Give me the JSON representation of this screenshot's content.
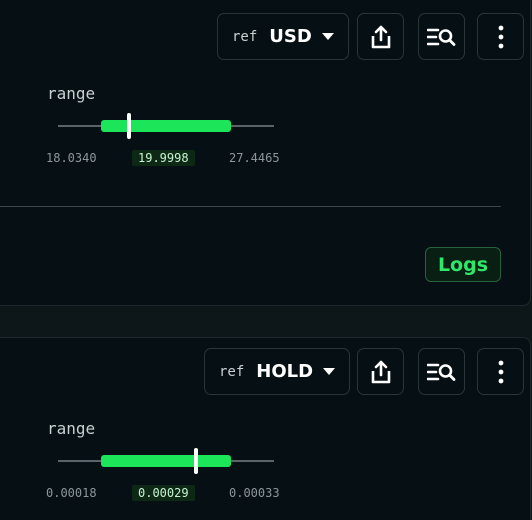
{
  "panels": [
    {
      "ref_prefix": "ref",
      "ref_value": "USD",
      "range_label": "range",
      "range_min": "18.0340",
      "range_current": "19.9998",
      "range_max": "27.4465",
      "range_low_fraction": 0.2,
      "range_high_fraction": 0.8,
      "range_marker_fraction": 0.33
    },
    {
      "ref_prefix": "ref",
      "ref_value": "HOLD",
      "range_label": "range",
      "range_min": "0.00018",
      "range_current": "0.00029",
      "range_max": "0.00033",
      "range_low_fraction": 0.2,
      "range_high_fraction": 0.8,
      "range_marker_fraction": 0.64
    }
  ],
  "logs_label": "Logs",
  "icons": {
    "dropdown": "caret-down-icon",
    "share": "share-icon",
    "search_list": "list-search-icon",
    "more": "more-vertical-icon"
  },
  "colors": {
    "background": "#0d1619",
    "card": "#061014",
    "range_fill": "#1de55a",
    "logs_text": "#2ee86a"
  }
}
